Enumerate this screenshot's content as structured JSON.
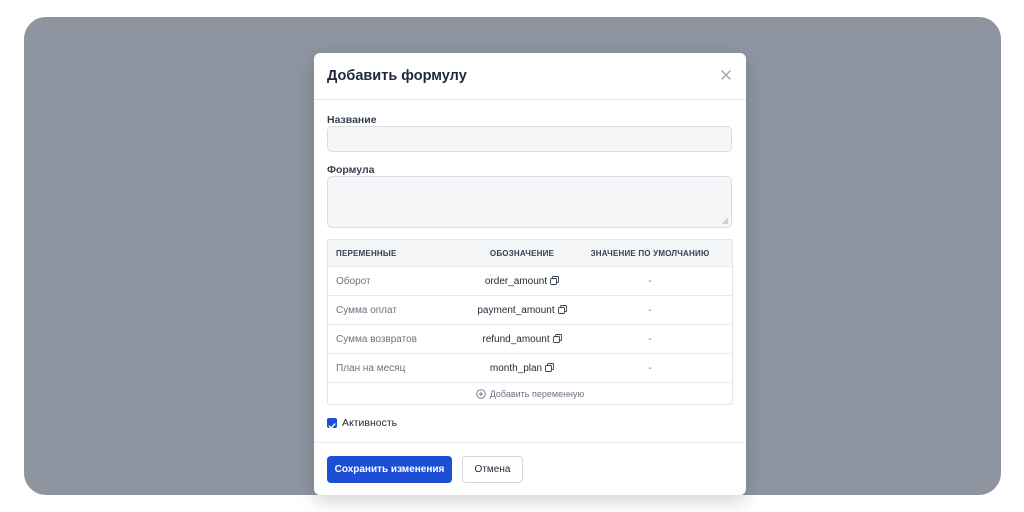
{
  "modal": {
    "title": "Добавить формулу",
    "close_icon": "close-icon"
  },
  "form": {
    "name_label": "Название",
    "name_value": "",
    "formula_label": "Формула",
    "formula_value": ""
  },
  "variables": {
    "headers": [
      "ПЕРЕМЕННЫЕ",
      "ОБОЗНАЧЕНИЕ",
      "ЗНАЧЕНИЕ ПО УМОЛЧАНИЮ"
    ],
    "rows": [
      {
        "name": "Оборот",
        "code": "order_amount",
        "default": "-"
      },
      {
        "name": "Сумма оплат",
        "code": "payment_amount",
        "default": "-"
      },
      {
        "name": "Сумма возвратов",
        "code": "refund_amount",
        "default": "-"
      },
      {
        "name": "План на месяц",
        "code": "month_plan",
        "default": "-"
      }
    ],
    "add_label": "Добавить переменную",
    "copy_icon": "copy-icon",
    "add_icon": "plus-circle-icon"
  },
  "active": {
    "label": "Активность",
    "checked": true
  },
  "footer": {
    "save_label": "Сохранить изменения",
    "cancel_label": "Отмена"
  },
  "colors": {
    "primary": "#1d4fd6",
    "backdrop": "#8f95a0"
  }
}
